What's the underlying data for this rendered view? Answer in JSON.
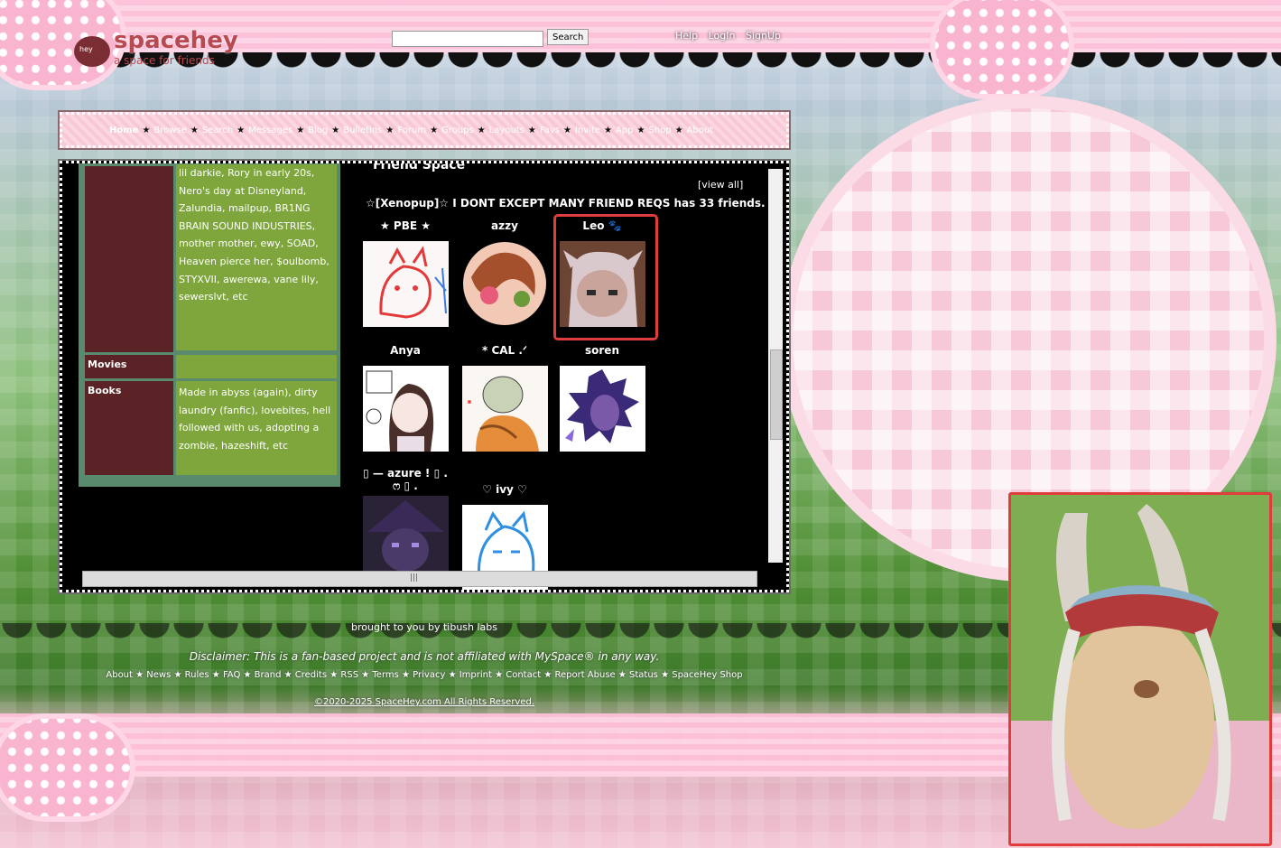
{
  "header": {
    "logo_badge": "hey",
    "logo_name": "spacehey",
    "logo_tagline": "a space for friends",
    "search_placeholder": "",
    "search_button": "Search",
    "links": [
      "Help",
      "LogIn",
      "SignUp"
    ]
  },
  "nav": {
    "items": [
      "Home",
      "Browse",
      "Search",
      "Messages",
      "Blog",
      "Bulletins",
      "Forum",
      "Groups",
      "Layouts",
      "Favs",
      "Invite",
      "App",
      "Shop",
      "About"
    ],
    "separator": "★"
  },
  "interests": {
    "rows": [
      {
        "label": "",
        "value": "lil darkie, Rory in early 20s, Nero's day at Disneyland, Zalundia, mailpup, BR1NG BRAIN SOUND INDUSTRIES, mother mother, ewy, SOAD, Heaven pierce her, $oulbomb, STYXVII, awerewa, vane lily, sewerslvt, etc"
      },
      {
        "label": "Movies",
        "value": ""
      },
      {
        "label": "Books",
        "value": "Made in abyss (again), dirty laundry (fanfic), lovebites, hell followed with us, adopting a zombie, hazeshift, etc"
      }
    ]
  },
  "friends": {
    "heading": "Friend Space",
    "view_all": "[view all]",
    "count_text": "☆[Xenopup]☆ I DONT EXCEPT MANY FRIEND REQS has 33 friends.",
    "list": [
      {
        "name": "★ PBE ★"
      },
      {
        "name": "azzy"
      },
      {
        "name": "Leo 🐾"
      },
      {
        "name": "Anya"
      },
      {
        "name": "* CAL .ᐟ"
      },
      {
        "name": "soren"
      },
      {
        "name": "▯ — azure ! ▯ . ෆ ▯ ."
      },
      {
        "name": "♡ ivy ♡"
      }
    ]
  },
  "footer": {
    "brought": "brought to you by tibush labs",
    "disclaimer": "Disclaimer: This is a fan-based project and is not affiliated with MySpace® in any way.",
    "links": [
      "About",
      "News",
      "Rules",
      "FAQ",
      "Brand",
      "Credits",
      "RSS",
      "Terms",
      "Privacy",
      "Imprint",
      "Contact",
      "Report Abuse",
      "Status",
      "SpaceHey Shop"
    ],
    "copyright": "©2020-2025 SpaceHey.com All Rights Reserved."
  },
  "colors": {
    "accent_red": "#e03c3c",
    "table_head": "#5b2325",
    "table_value": "#7ea63d",
    "logo": "#b84a52"
  }
}
